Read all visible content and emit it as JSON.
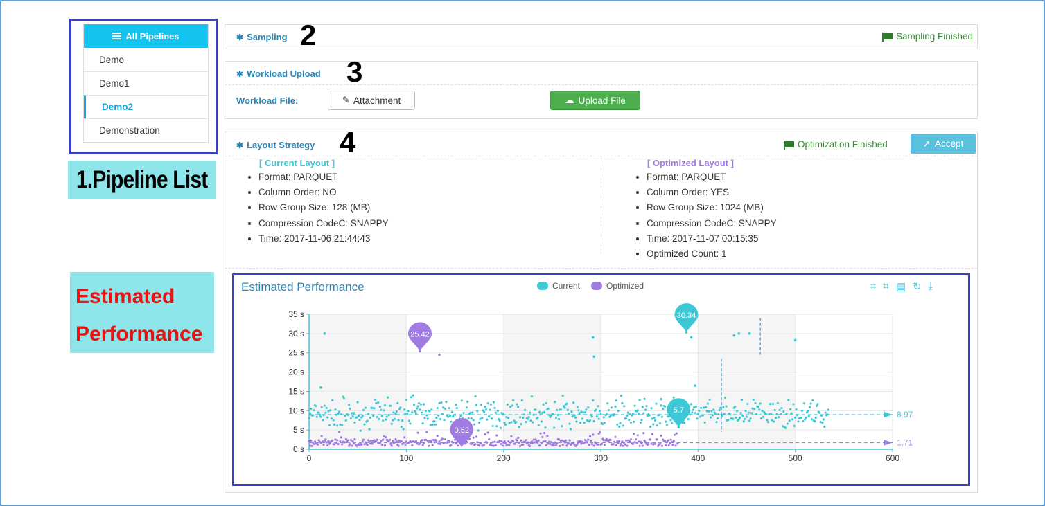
{
  "sidebar": {
    "header": "All Pipelines",
    "items": [
      "Demo",
      "Demo1",
      "Demo2",
      "Demonstration"
    ],
    "active_index": 2
  },
  "annotations": {
    "pipeline_list": "1.Pipeline List",
    "estimated_performance_line1": "Estimated",
    "estimated_performance_line2": "Performance",
    "n2": "2",
    "n3": "3",
    "n4": "4"
  },
  "sampling": {
    "title": "Sampling",
    "status": "Sampling Finished"
  },
  "workload": {
    "title": "Workload Upload",
    "file_label": "Workload File:",
    "attach_button": "Attachment",
    "upload_button": "Upload File"
  },
  "layout": {
    "title": "Layout Strategy",
    "status": "Optimization Finished",
    "accept_button": "Accept",
    "current": {
      "heading": "[ Current Layout ]",
      "items": [
        "Format: PARQUET",
        "Column Order: NO",
        "Row Group Size: 128 (MB)",
        "Compression CodeC: SNAPPY",
        "Time: 2017-11-06 21:44:43"
      ]
    },
    "optimized": {
      "heading": "[ Optimized Layout ]",
      "items": [
        "Format: PARQUET",
        "Column Order: YES",
        "Row Group Size: 1024 (MB)",
        "Compression CodeC: SNAPPY",
        "Time: 2017-11-07 00:15:35",
        "Optimized Count: 1"
      ]
    }
  },
  "colors": {
    "current": "#3ec8d6",
    "optimized": "#a07be2",
    "accent": "#2a87b8",
    "green": "#4cae4c"
  },
  "chart_data": {
    "type": "scatter",
    "title": "Estimated Performance",
    "legend": [
      "Current",
      "Optimized"
    ],
    "legend_position": "top-center",
    "x_ticks": [
      "0",
      "100",
      "200",
      "300",
      "400",
      "500",
      "600"
    ],
    "y_ticks": [
      "0 s",
      "5 s",
      "10 s",
      "15 s",
      "20 s",
      "25 s",
      "30 s",
      "35 s"
    ],
    "xlim": [
      0,
      600
    ],
    "ylim": [
      0,
      35
    ],
    "grid": true,
    "series": [
      {
        "name": "Current",
        "color": "#3ec8d6",
        "n_points": 535,
        "typical_range": [
          5,
          13
        ],
        "outliers": [
          [
            16,
            30
          ],
          [
            12,
            16
          ],
          [
            292,
            29
          ],
          [
            293,
            24
          ],
          [
            388,
            30.34
          ],
          [
            393,
            29
          ],
          [
            437,
            29.5
          ],
          [
            442,
            30
          ],
          [
            453,
            30
          ],
          [
            500,
            28.3
          ],
          [
            397,
            16.5
          ],
          [
            362,
            13
          ],
          [
            380,
            5.7
          ]
        ],
        "max": {
          "x": 388,
          "y": 30.34,
          "label": "30.34"
        },
        "min": {
          "x": 380,
          "y": 5.7,
          "label": "5.7"
        },
        "mean": {
          "y": 8.97,
          "label": "8.97"
        }
      },
      {
        "name": "Optimized",
        "color": "#a07be2",
        "n_points": 380,
        "typical_range": [
          0,
          4
        ],
        "outliers": [
          [
            114,
            25.42
          ],
          [
            134,
            24.5
          ]
        ],
        "max": {
          "x": 114,
          "y": 25.42,
          "label": "25.42"
        },
        "min": {
          "x": 157,
          "y": 0.52,
          "label": "0.52"
        },
        "mean": {
          "y": 1.71,
          "label": "1.71"
        }
      }
    ],
    "mark_lines_x": [
      {
        "x": 464,
        "y_range": [
          24.5,
          34
        ]
      },
      {
        "x": 424,
        "y_range": [
          4.5,
          23.5
        ]
      }
    ]
  }
}
